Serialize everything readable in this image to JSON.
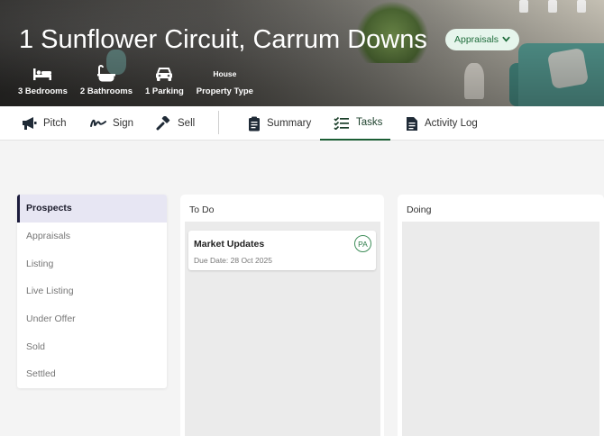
{
  "property": {
    "address": "1 Sunflower Circuit, Carrum Downs",
    "status": "Appraisals",
    "features": [
      {
        "icon": "bed-icon",
        "label": "3 Bedrooms"
      },
      {
        "icon": "bath-icon",
        "label": "2 Bathrooms"
      },
      {
        "icon": "car-icon",
        "label": "1 Parking"
      },
      {
        "value": "House",
        "label": "Property Type"
      }
    ]
  },
  "tabs": [
    {
      "icon": "megaphone-icon",
      "label": "Pitch"
    },
    {
      "icon": "signature-icon",
      "label": "Sign"
    },
    {
      "icon": "gavel-icon",
      "label": "Sell"
    },
    {
      "icon": "clipboard-icon",
      "label": "Summary"
    },
    {
      "icon": "checklist-icon",
      "label": "Tasks",
      "active": true
    },
    {
      "icon": "document-icon",
      "label": "Activity Log"
    }
  ],
  "stages": [
    "Prospects",
    "Appraisals",
    "Listing",
    "Live Listing",
    "Under Offer",
    "Sold",
    "Settled"
  ],
  "active_stage": "Prospects",
  "columns": {
    "todo": {
      "title": "To Do",
      "cards": [
        {
          "title": "Market Updates",
          "due": "Due Date: 28 Oct 2025",
          "assignee": "PA"
        }
      ]
    },
    "doing": {
      "title": "Doing"
    }
  },
  "colors": {
    "accent": "#1b5e35",
    "pill_bg": "#e6f5ec",
    "active_stage_bg": "#e7e6f3"
  }
}
